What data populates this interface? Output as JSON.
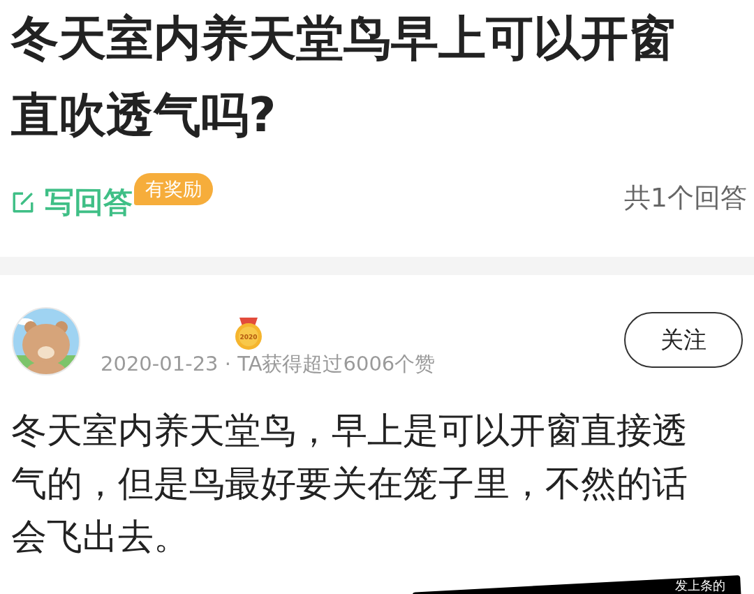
{
  "question": {
    "title": "冬天室内养天堂鸟早上可以开窗直吹透气吗?",
    "write_answer": {
      "label": "写回答",
      "badge": "有奖励"
    },
    "answer_count": "共1个回答"
  },
  "answers": [
    {
      "medal": {
        "label": "2020"
      },
      "meta": "2020-01-23 · TA获得超过6006个赞",
      "follow": {
        "label": "关注",
        "selected": false
      },
      "text": "冬天室内养天堂鸟，早上是可以开窗直接透气的，但是鸟最好要关在笼子里，不然的话会飞出去。"
    }
  ],
  "caption_overlay": {
    "text": "发上条的"
  }
}
